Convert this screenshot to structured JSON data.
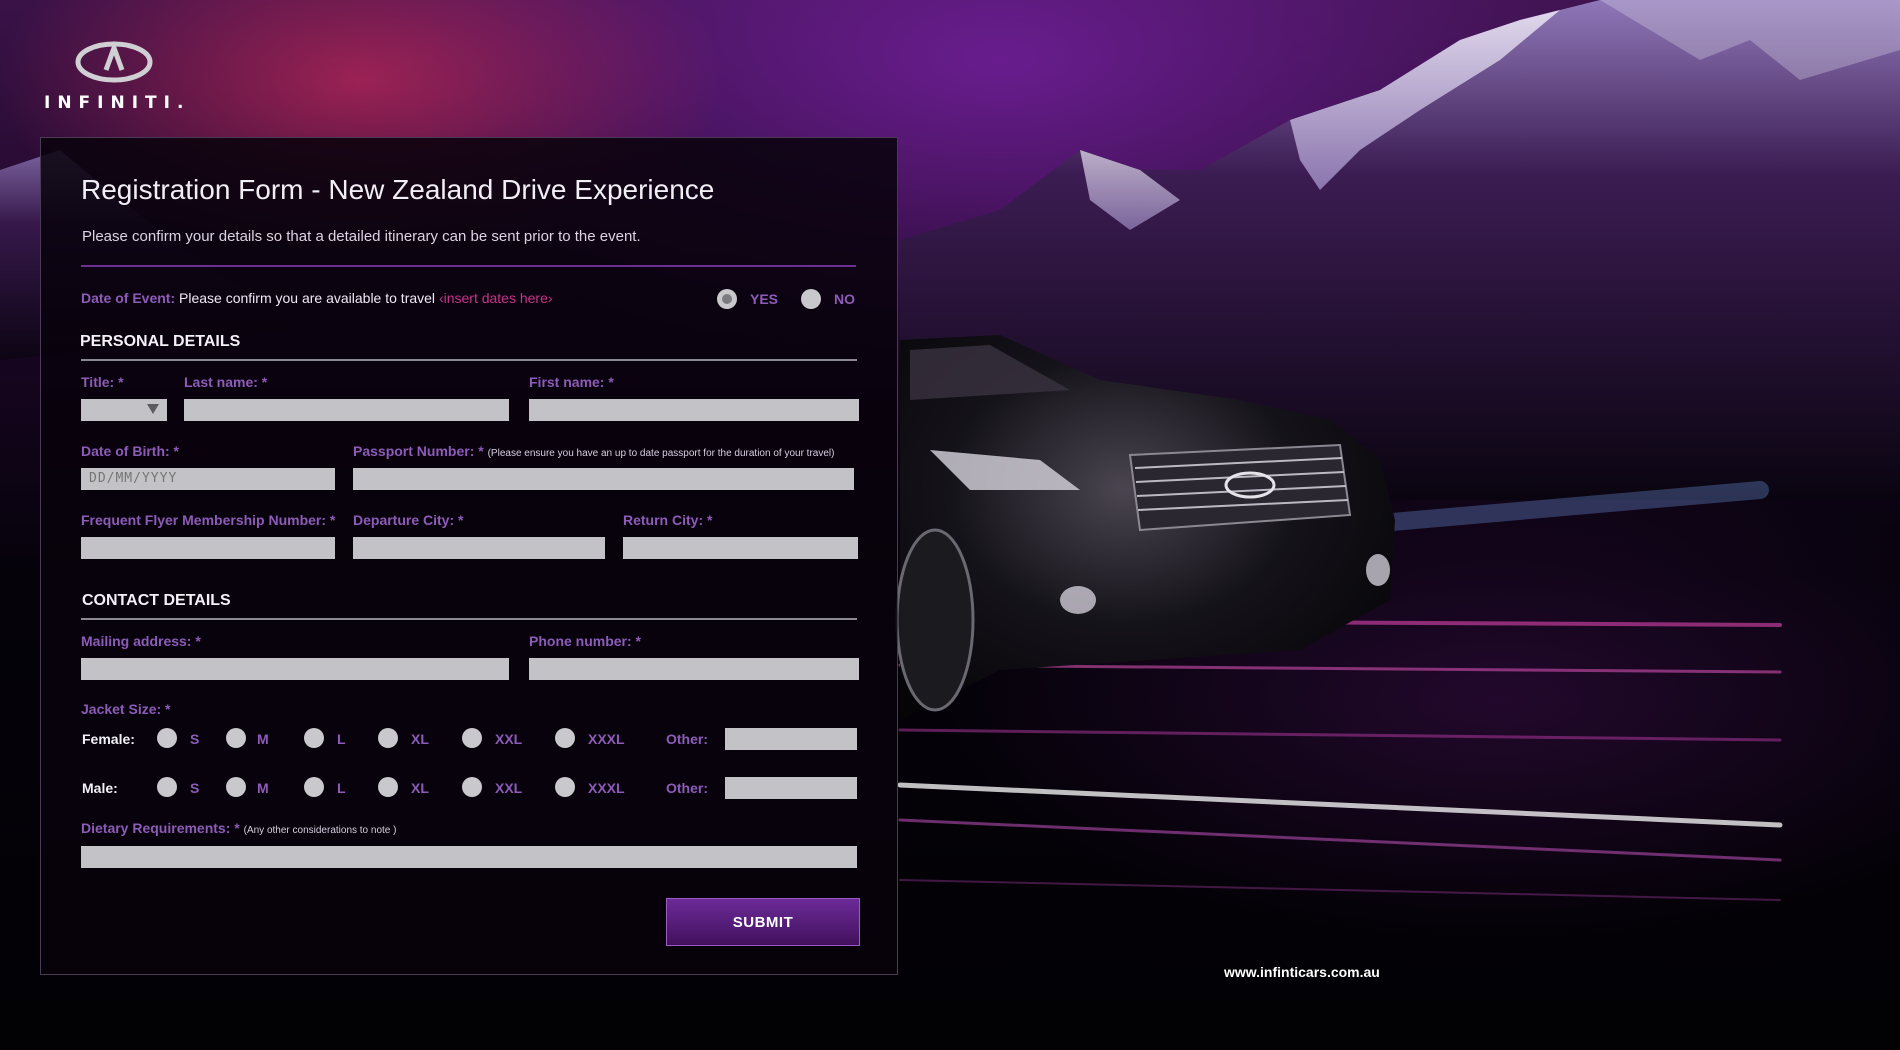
{
  "brand": {
    "name": "INFINITI.",
    "url": "www.infinticars.com.au"
  },
  "form": {
    "title": "Registration Form - New Zealand Drive Experience",
    "subtitle": "Please confirm your details so that a detailed itinerary can be sent prior to the event.",
    "event": {
      "label": "Date of Event:",
      "text": "Please confirm you are available to travel",
      "dates": "‹insert dates here›",
      "yes": "YES",
      "no": "NO",
      "selected": "YES"
    },
    "personal": {
      "heading": "PERSONAL DETAILS",
      "title_label": "Title: *",
      "last_name_label": "Last name: *",
      "first_name_label": "First name: *",
      "dob_label": "Date of Birth: *",
      "dob_placeholder": "DD/MM/YYYY",
      "passport_label": "Passport Number: *",
      "passport_note": "(Please ensure you have an up to date passport for the duration of your travel)",
      "ffm_label": "Frequent Flyer Membership Number: *",
      "departure_label": "Departure City: *",
      "return_label": "Return City: *"
    },
    "contact": {
      "heading": "CONTACT DETAILS",
      "mailing_label": "Mailing address: *",
      "phone_label": "Phone number: *",
      "jacket_label": "Jacket Size: *",
      "female_label": "Female:",
      "male_label": "Male:",
      "sizes": [
        "S",
        "M",
        "L",
        "XL",
        "XXL",
        "XXXL"
      ],
      "other_label": "Other:",
      "dietary_label": "Dietary Requirements: *",
      "dietary_note": "(Any other considerations to note )"
    },
    "submit": "SUBMIT"
  }
}
